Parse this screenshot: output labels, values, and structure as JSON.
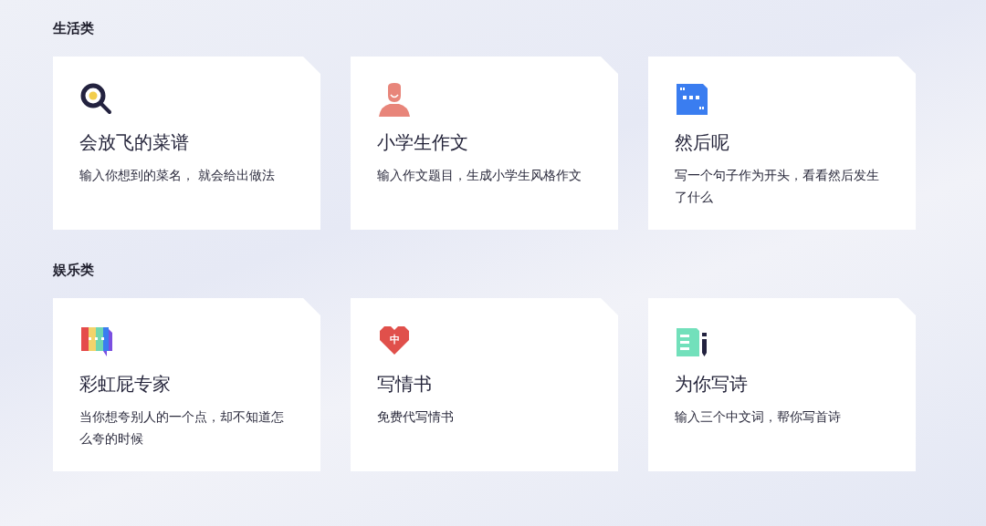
{
  "sections": [
    {
      "title": "生活类",
      "cards": [
        {
          "kind": "magnifier",
          "title": "会放飞的菜谱",
          "description": "输入你想到的菜名， 就会给出做法"
        },
        {
          "kind": "person",
          "title": "小学生作文",
          "description": "输入作文题目，生成小学生风格作文"
        },
        {
          "kind": "quote",
          "title": "然后呢",
          "description": "写一个句子作为开头，看看然后发生了什么"
        }
      ]
    },
    {
      "title": "娱乐类",
      "cards": [
        {
          "kind": "rainbow",
          "title": "彩虹屁专家",
          "description": "当你想夸别人的一个点，却不知道怎么夸的时候"
        },
        {
          "kind": "heart",
          "icon_text": "中",
          "title": "写情书",
          "description": "免费代写情书"
        },
        {
          "kind": "poem",
          "title": "为你写诗",
          "description": "输入三个中文词，帮你写首诗"
        }
      ]
    }
  ]
}
